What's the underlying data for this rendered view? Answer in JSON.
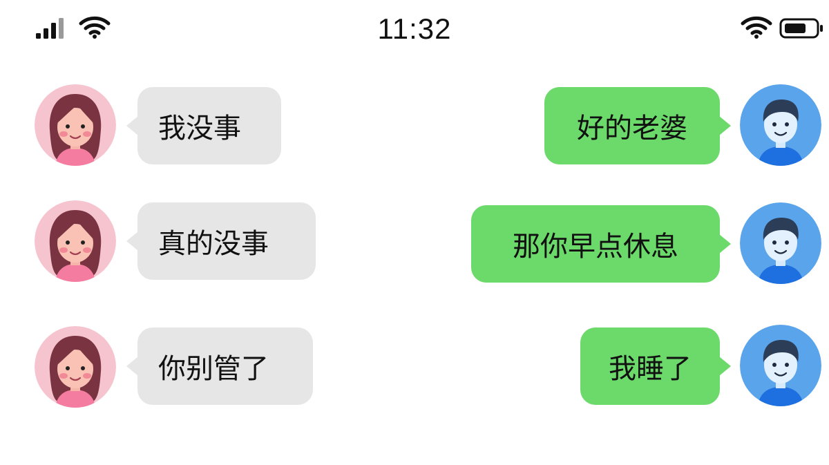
{
  "status_bar": {
    "time": "11:32",
    "icons": [
      "cellular-signal-icon",
      "wifi-icon",
      "wifi-icon",
      "battery-icon"
    ]
  },
  "colors": {
    "incoming_bubble": "#e6e6e6",
    "outgoing_bubble": "#6cd96b",
    "background": "#ffffff"
  },
  "messages": [
    {
      "side": "left",
      "sender_avatar": "female-avatar-icon",
      "text": "我没事"
    },
    {
      "side": "right",
      "sender_avatar": "male-avatar-icon",
      "text": "好的老婆"
    },
    {
      "side": "left",
      "sender_avatar": "female-avatar-icon",
      "text": "真的没事"
    },
    {
      "side": "right",
      "sender_avatar": "male-avatar-icon",
      "text": "那你早点休息"
    },
    {
      "side": "left",
      "sender_avatar": "female-avatar-icon",
      "text": "你别管了"
    },
    {
      "side": "right",
      "sender_avatar": "male-avatar-icon",
      "text": "我睡了"
    }
  ]
}
